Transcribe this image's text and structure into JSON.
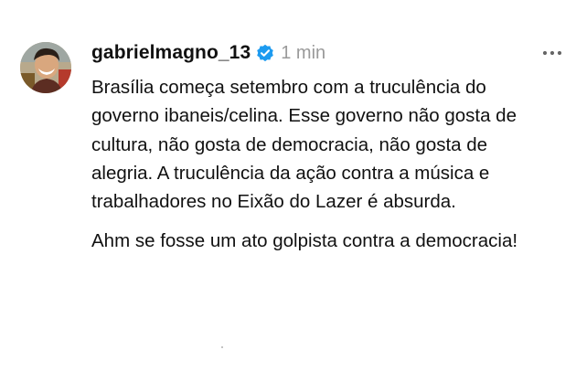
{
  "post": {
    "username": "gabrielmagno_13",
    "verified_icon": "verified-badge-icon",
    "timestamp": "1 min",
    "more_icon": "more-horizontal-icon",
    "paragraphs": [
      "Brasília começa setembro com a truculência do governo ibaneis/celina. Esse governo não gosta de cultura, não gosta de democracia, não gosta de alegria. A truculência da ação contra a música e trabalhadores no Eixão do Lazer é absurda.",
      "Ahm se fosse um ato golpista contra a democracia!"
    ]
  },
  "colors": {
    "verified": "#1d9bf0",
    "timestamp": "#9a9a9a",
    "text": "#111111",
    "background": "#ffffff"
  }
}
